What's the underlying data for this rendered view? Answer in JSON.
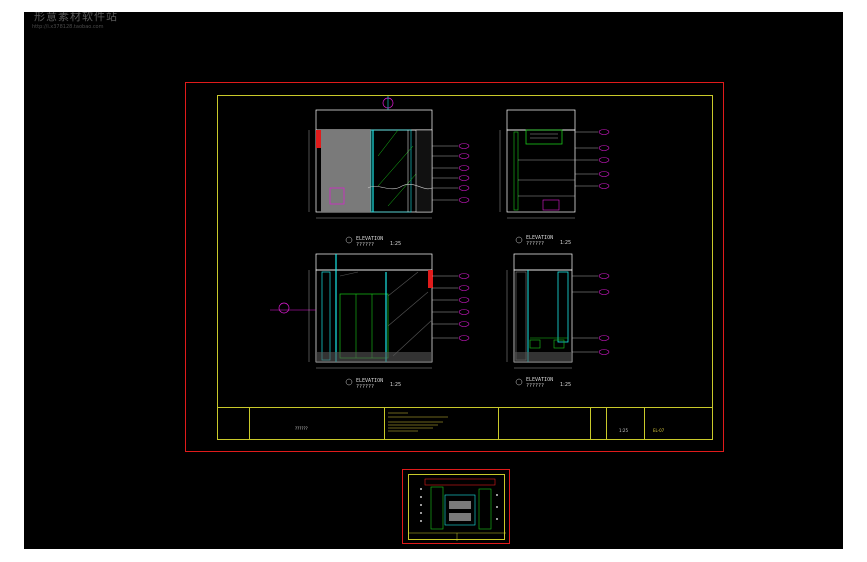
{
  "watermark": {
    "name": "形意素材软件站",
    "url": "http://i.x378128.taobao.com"
  },
  "drawing": {
    "elevations": [
      {
        "id": "elev-top-left",
        "title": "ELEVATION",
        "ref": "??????",
        "scale": "1:25"
      },
      {
        "id": "elev-top-right",
        "title": "ELEVATION",
        "ref": "??????",
        "scale": "1:25"
      },
      {
        "id": "elev-bottom-left",
        "title": "ELEVATION",
        "ref": "??????",
        "scale": "1:25"
      },
      {
        "id": "elev-bottom-right",
        "title": "ELEVATION",
        "ref": "??????",
        "scale": "1:25"
      }
    ],
    "title_block": {
      "scale": "1:25",
      "drawing_no": "EL-07",
      "project_ref": "??????"
    }
  },
  "colors": {
    "background": "#000000",
    "sheet_border": "#e01b1b",
    "inner_border": "#c9c92a",
    "wall_fill": "#7a7a7a",
    "cyan": "#19e6e6",
    "magenta": "#e01bd6",
    "green": "#19c819",
    "white": "#ffffff"
  }
}
